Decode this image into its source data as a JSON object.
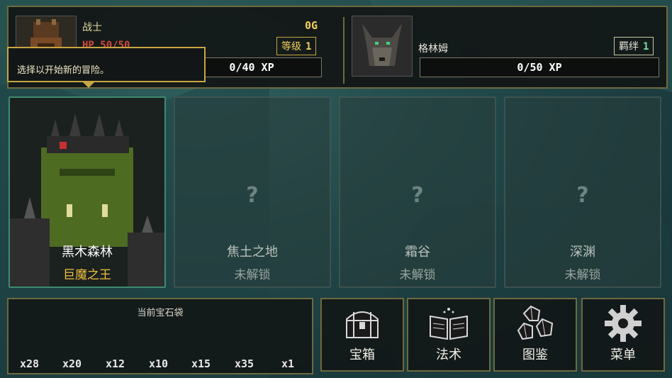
{
  "hero": {
    "class_name": "战士",
    "hp": "HP 50/50",
    "gold": "0G",
    "level_label": "等级",
    "level_value": "1",
    "xp": "0/40 XP"
  },
  "companion": {
    "name": "格林姆",
    "bond_label": "羁绊",
    "bond_value": "1",
    "xp": "0/50 XP"
  },
  "tooltip": "选择以开始新的冒险。",
  "stages": [
    {
      "title": "黑木森林",
      "subtitle": "巨魔之王",
      "unlocked": true
    },
    {
      "title": "焦土之地",
      "subtitle": "未解锁",
      "placeholder": "?",
      "unlocked": false
    },
    {
      "title": "霜谷",
      "subtitle": "未解锁",
      "placeholder": "?",
      "unlocked": false
    },
    {
      "title": "深渊",
      "subtitle": "未解锁",
      "placeholder": "?",
      "unlocked": false
    }
  ],
  "gem_bag": {
    "title": "当前宝石袋",
    "counts": [
      "x28",
      "x20",
      "x12",
      "x10",
      "x15",
      "x35",
      "x1"
    ]
  },
  "menu_buttons": [
    {
      "label": "宝箱",
      "icon": "treasure-chest-icon"
    },
    {
      "label": "法术",
      "icon": "spellbook-icon"
    },
    {
      "label": "图鉴",
      "icon": "dice-icon"
    },
    {
      "label": "菜单",
      "icon": "gear-icon"
    }
  ],
  "colors": {
    "frame_gold": "#c8a640",
    "hp_red": "#d24a3a",
    "gold_yellow": "#f0d060",
    "active_border": "#3f8a70"
  }
}
